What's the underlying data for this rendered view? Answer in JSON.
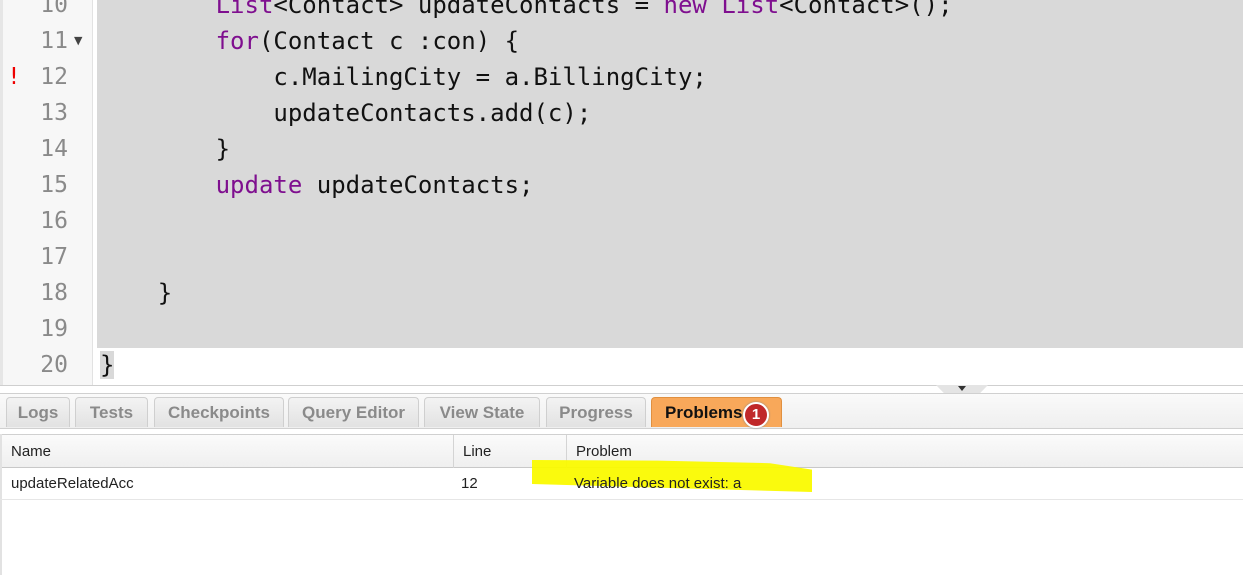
{
  "editor": {
    "lines": [
      {
        "n": "10",
        "indent": "        ",
        "parts": [
          [
            "kw",
            "List"
          ],
          [
            "",
            "<Contact> updateContacts = "
          ],
          [
            "kw",
            "new"
          ],
          [
            "",
            " "
          ],
          [
            "kw",
            "List"
          ],
          [
            "",
            "<Contact>();"
          ]
        ]
      },
      {
        "n": "11",
        "indent": "        ",
        "fold": true,
        "parts": [
          [
            "kw",
            "for"
          ],
          [
            "",
            "(Contact c :con) {"
          ]
        ]
      },
      {
        "n": "12",
        "indent": "            ",
        "error": true,
        "parts": [
          [
            "",
            "c.MailingCity = a.BillingCity;"
          ]
        ]
      },
      {
        "n": "13",
        "indent": "            ",
        "parts": [
          [
            "",
            "updateContacts.add(c);"
          ]
        ]
      },
      {
        "n": "14",
        "indent": "        ",
        "parts": [
          [
            "",
            "}"
          ]
        ]
      },
      {
        "n": "15",
        "indent": "        ",
        "parts": [
          [
            "kw",
            "update"
          ],
          [
            "",
            " updateContacts;"
          ]
        ]
      },
      {
        "n": "16",
        "indent": "",
        "parts": []
      },
      {
        "n": "17",
        "indent": "",
        "parts": []
      },
      {
        "n": "18",
        "indent": "    ",
        "parts": [
          [
            "",
            "}"
          ]
        ]
      },
      {
        "n": "19",
        "indent": "",
        "parts": []
      },
      {
        "n": "20",
        "indent": "",
        "parts": [
          [
            "selc",
            "}"
          ]
        ]
      }
    ],
    "error_marker": "!",
    "fold_icon": "triangle-down-icon",
    "colors": {
      "keyword": "#7f0f8f",
      "error": "#e00000",
      "selection": "#d9d9d9"
    }
  },
  "tabs": [
    {
      "label": "Logs",
      "active": false
    },
    {
      "label": "Tests",
      "active": false
    },
    {
      "label": "Checkpoints",
      "active": false
    },
    {
      "label": "Query Editor",
      "active": false
    },
    {
      "label": "View State",
      "active": false
    },
    {
      "label": "Progress",
      "active": false
    },
    {
      "label": "Problems",
      "active": true,
      "badge": "1"
    }
  ],
  "problems": {
    "columns": [
      "Name",
      "Line",
      "Problem"
    ],
    "rows": [
      [
        "updateRelatedAcc",
        "12",
        "Variable does not exist: a"
      ]
    ],
    "highlight_color": "#fafa00"
  }
}
